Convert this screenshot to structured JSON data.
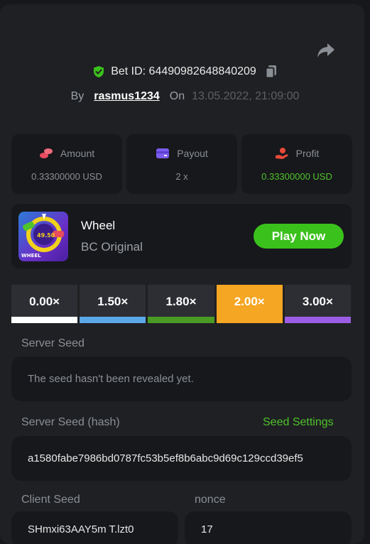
{
  "header": {
    "bet_id_label": "Bet ID: 64490982648840209",
    "by_label": "By",
    "username": "rasmus1234",
    "on_label": "On",
    "date": "13.05.2022, 21:09:00"
  },
  "stats": [
    {
      "label": "Amount",
      "value": "0.33300000 USD",
      "icon": "coins-icon",
      "color": "#e84a5f"
    },
    {
      "label": "Payout",
      "value": "2 x",
      "icon": "card-icon",
      "color": "#7b5cf0"
    },
    {
      "label": "Profit",
      "value": "0.33300000 USD",
      "icon": "hand-coin-icon",
      "color": "#e84a3a"
    }
  ],
  "game": {
    "name": "Wheel",
    "provider": "BC Original",
    "thumb_label": "WHEEL",
    "play_label": "Play Now"
  },
  "multipliers": [
    {
      "label": "0.00×",
      "color": "#ffffff"
    },
    {
      "label": "1.50×",
      "color": "#5aa8e8"
    },
    {
      "label": "1.80×",
      "color": "#4a9b24"
    },
    {
      "label": "2.00×",
      "color": "#f5a623"
    },
    {
      "label": "3.00×",
      "color": "#9b5de5"
    }
  ],
  "server_seed": {
    "label": "Server Seed",
    "value": "The seed hasn't been revealed yet."
  },
  "server_seed_hash": {
    "label": "Server Seed (hash)",
    "settings_label": "Seed Settings",
    "value": "a1580fabe7986bd0787fc53b5ef8b6abc9d69c129ccd39ef5"
  },
  "client_seed": {
    "label": "Client Seed",
    "value": "SHmxi63AAY5m T.lzt0"
  },
  "nonce": {
    "label": "nonce",
    "value": "17"
  },
  "colors": {
    "accent_green": "#3bc11c",
    "active_orange": "#f5a623",
    "panel_bg": "#1f2023",
    "card_bg": "#17181b"
  }
}
